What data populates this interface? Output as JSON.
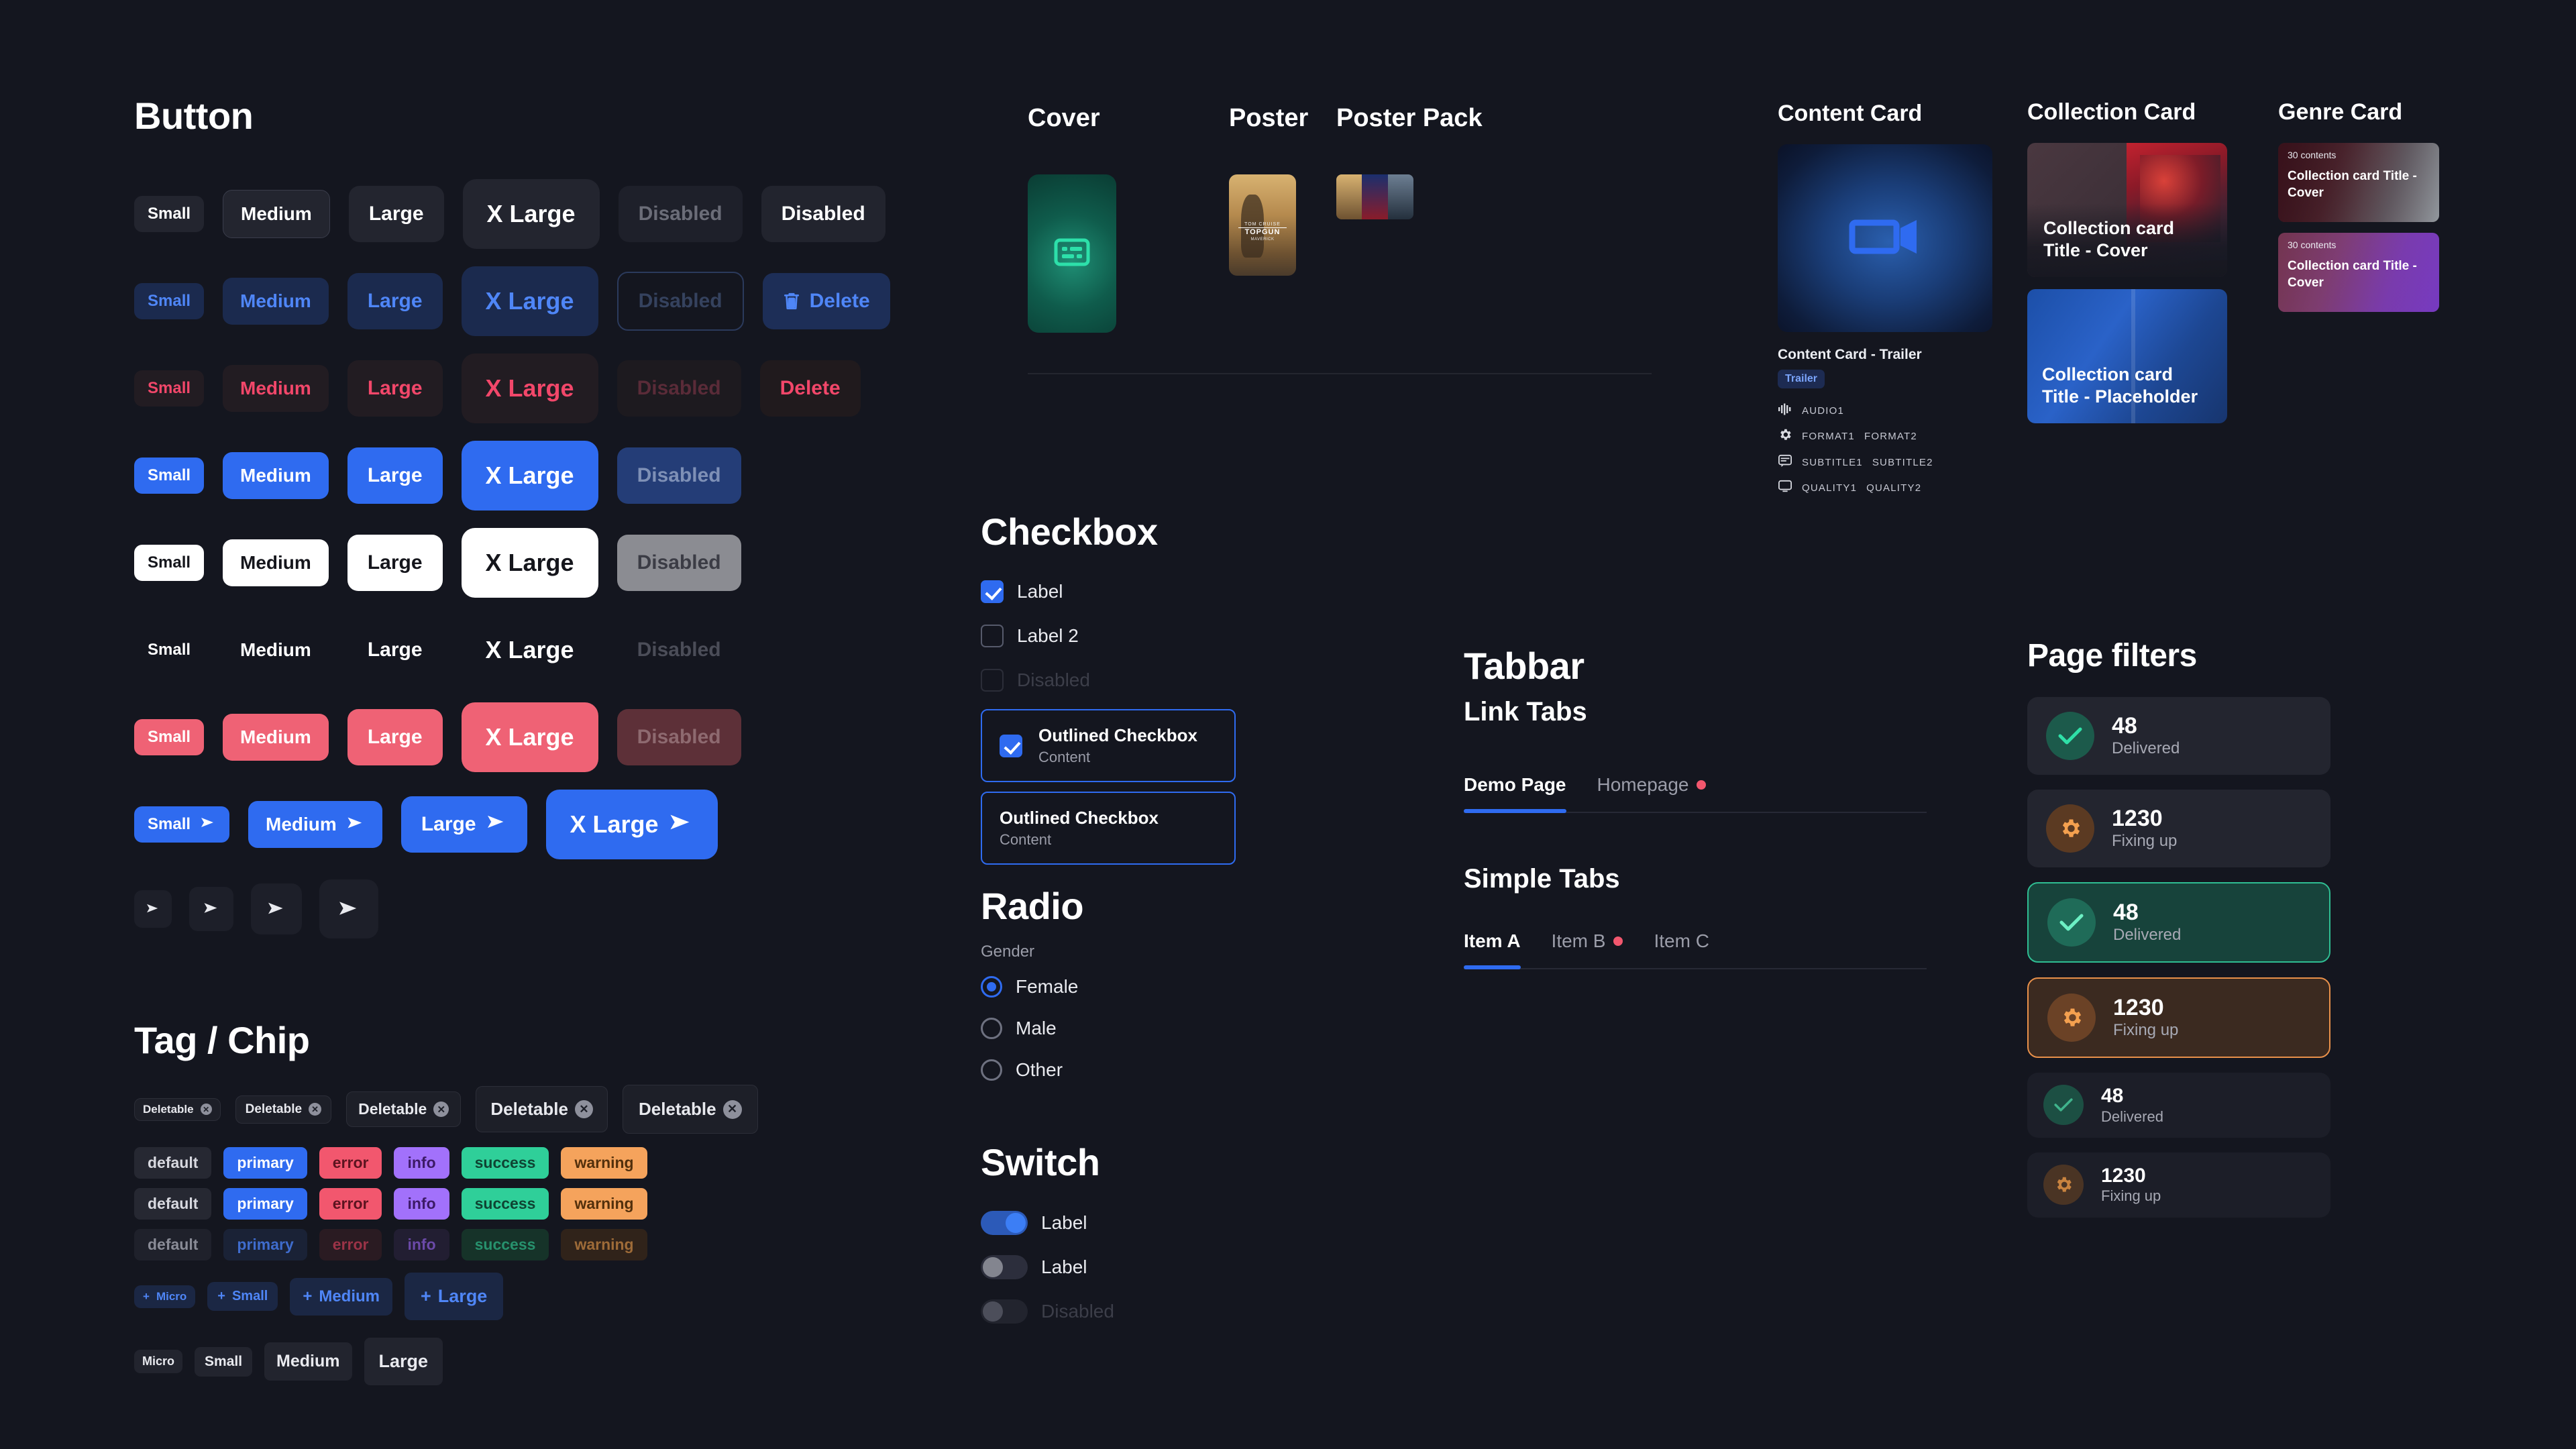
{
  "colors": {
    "bg": "#14161f",
    "primary": "#2f6bf0",
    "error": "#f2476a",
    "success": "#2fbd92",
    "warning": "#f0a258",
    "info": "#a271fb",
    "pink": "#ef6275"
  },
  "button_section": {
    "title": "Button",
    "sizes": [
      "Small",
      "Medium",
      "Large",
      "X Large"
    ],
    "rows": [
      {
        "variant": "soft-dark",
        "labels": [
          "Small",
          "Medium",
          "Large",
          "X Large",
          "Disabled",
          "Disabled"
        ]
      },
      {
        "variant": "soft-blue",
        "labels": [
          "Small",
          "Medium",
          "Large",
          "X Large",
          "Disabled",
          "Delete"
        ]
      },
      {
        "variant": "soft-red",
        "labels": [
          "Small",
          "Medium",
          "Large",
          "X Large",
          "Disabled",
          "Delete"
        ]
      },
      {
        "variant": "primary",
        "labels": [
          "Small",
          "Medium",
          "Large",
          "X Large",
          "Disabled"
        ]
      },
      {
        "variant": "white",
        "labels": [
          "Small",
          "Medium",
          "Large",
          "X Large",
          "Disabled"
        ]
      },
      {
        "variant": "text",
        "labels": [
          "Small",
          "Medium",
          "Large",
          "X Large",
          "Disabled"
        ]
      },
      {
        "variant": "pink",
        "labels": [
          "Small",
          "Medium",
          "Large",
          "X Large",
          "Disabled"
        ]
      },
      {
        "variant": "primary-icon",
        "labels": [
          "Small",
          "Medium",
          "Large",
          "X Large"
        ]
      },
      {
        "variant": "icon-only",
        "labels": [
          "",
          "",
          "",
          ""
        ]
      }
    ],
    "delete_icon": "trash-icon",
    "arrow_icon": "arrow-right-icon"
  },
  "tag_section": {
    "title": "Tag / Chip",
    "deletable_label": "Deletable",
    "deletable_count": 5,
    "close_icon": "close-circle-icon",
    "tag_variants": [
      "default",
      "primary",
      "error",
      "info",
      "success",
      "warning"
    ],
    "tag_rows": [
      "filled",
      "filled",
      "disabled"
    ],
    "add_icon": "plus-icon",
    "add_sizes": [
      "Micro",
      "Small",
      "Medium",
      "Large"
    ],
    "plain_sizes": [
      "Micro",
      "Small",
      "Medium",
      "Large"
    ]
  },
  "media": {
    "cover_title": "Cover",
    "poster_title": "Poster",
    "poster_pack_title": "Poster Pack",
    "cover_icon": "placeholder-cover-icon",
    "poster_name": "Top Gun Maverick poster",
    "poster_pack_names": [
      "Top Gun Maverick poster",
      "Stranger Things poster",
      "Movie poster"
    ]
  },
  "checkbox_section": {
    "title": "Checkbox",
    "items": [
      {
        "label": "Label",
        "checked": true,
        "disabled": false
      },
      {
        "label": "Label 2",
        "checked": false,
        "disabled": false
      },
      {
        "label": "Disabled",
        "checked": false,
        "disabled": true
      }
    ],
    "outlined": [
      {
        "title": "Outlined Checkbox",
        "content": "Content",
        "checked": true,
        "show_box": true
      },
      {
        "title": "Outlined Checkbox",
        "content": "Content",
        "checked": false,
        "show_box": false
      }
    ]
  },
  "radio_section": {
    "title": "Radio",
    "group_label": "Gender",
    "options": [
      {
        "label": "Female",
        "selected": true
      },
      {
        "label": "Male",
        "selected": false
      },
      {
        "label": "Other",
        "selected": false
      }
    ]
  },
  "switch_section": {
    "title": "Switch",
    "items": [
      {
        "label": "Label",
        "on": true,
        "disabled": false
      },
      {
        "label": "Label",
        "on": false,
        "disabled": false
      },
      {
        "label": "Disabled",
        "on": false,
        "disabled": true
      }
    ]
  },
  "tabbar_section": {
    "title": "Tabbar",
    "link_tabs_title": "Link Tabs",
    "link_tabs": [
      {
        "label": "Demo Page",
        "active": true,
        "dot": false
      },
      {
        "label": "Homepage",
        "active": false,
        "dot": true
      }
    ],
    "simple_tabs_title": "Simple Tabs",
    "simple_tabs": [
      {
        "label": "Item A",
        "active": true,
        "dot": false
      },
      {
        "label": "Item B",
        "active": false,
        "dot": true
      },
      {
        "label": "Item C",
        "active": false,
        "dot": false
      }
    ]
  },
  "content_card": {
    "title": "Content Card",
    "name": "Content Card - Trailer",
    "badge": "Trailer",
    "thumb_icon": "video-camera-icon",
    "meta": [
      {
        "icon": "audio-wave-icon",
        "values": [
          "AUDIO1"
        ]
      },
      {
        "icon": "gear-icon",
        "values": [
          "FORMAT1",
          "FORMAT2"
        ]
      },
      {
        "icon": "subtitle-icon",
        "values": [
          "SUBTITLE1",
          "SUBTITLE2"
        ]
      },
      {
        "icon": "monitor-icon",
        "values": [
          "QUALITY1",
          "QUALITY2"
        ]
      }
    ]
  },
  "collection_card": {
    "title": "Collection Card",
    "cards": [
      {
        "title": "Collection card Title - Cover",
        "kind": "cover"
      },
      {
        "title": "Collection card Title - Placeholder",
        "kind": "placeholder"
      }
    ]
  },
  "genre_card": {
    "title": "Genre Card",
    "cards": [
      {
        "contents": "30 contents",
        "title": "Collection card Title - Cover"
      },
      {
        "contents": "30 contents",
        "title": "Collection card Title - Cover"
      }
    ]
  },
  "page_filters": {
    "title": "Page filters",
    "items": [
      {
        "count": "48",
        "label": "Delivered",
        "icon": "check-icon",
        "state": "default-green"
      },
      {
        "count": "1230",
        "label": "Fixing up",
        "icon": "gear-icon",
        "state": "default-orange"
      },
      {
        "count": "48",
        "label": "Delivered",
        "icon": "check-icon",
        "state": "selected-green"
      },
      {
        "count": "1230",
        "label": "Fixing up",
        "icon": "gear-icon",
        "state": "selected-orange"
      },
      {
        "count": "48",
        "label": "Delivered",
        "icon": "check-icon",
        "state": "muted-green"
      },
      {
        "count": "1230",
        "label": "Fixing up",
        "icon": "gear-icon",
        "state": "muted-orange"
      }
    ]
  }
}
